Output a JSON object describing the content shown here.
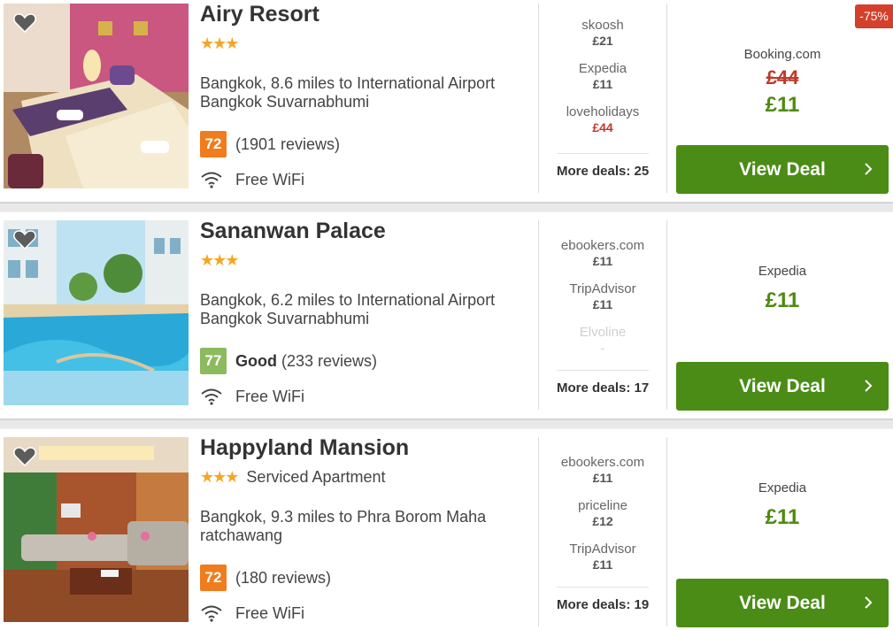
{
  "hotels": [
    {
      "name": "Airy Resort",
      "stars": "★★★",
      "stay_type": "",
      "location": "Bangkok, 8.6 miles to International Airport Bangkok Suvarnabhumi",
      "score": "72",
      "score_label": "",
      "reviews": "(1901 reviews)",
      "amenity": "Free WiFi",
      "deals": [
        {
          "provider": "skoosh",
          "price": "£21"
        },
        {
          "provider": "Expedia",
          "price": "£11"
        },
        {
          "provider": "loveholidays",
          "price": "£44"
        }
      ],
      "more_deals": "More deals: 25",
      "best": {
        "provider": "Booking.com",
        "old_price": "£44",
        "price": "£11"
      },
      "discount": "-75%",
      "button": "View Deal"
    },
    {
      "name": "Sananwan Palace",
      "stars": "★★★",
      "stay_type": "",
      "location": "Bangkok, 6.2 miles to International Airport Bangkok Suvarnabhumi",
      "score": "77",
      "score_label": "Good",
      "reviews": "(233 reviews)",
      "amenity": "Free WiFi",
      "deals": [
        {
          "provider": "ebookers.com",
          "price": "£11"
        },
        {
          "provider": "TripAdvisor",
          "price": "£11"
        },
        {
          "provider": "Elvoline",
          "price": "-"
        }
      ],
      "more_deals": "More deals: 17",
      "best": {
        "provider": "Expedia",
        "old_price": "",
        "price": "£11"
      },
      "discount": "",
      "button": "View Deal"
    },
    {
      "name": "Happyland Mansion",
      "stars": "★★★",
      "stay_type": "Serviced Apartment",
      "location": "Bangkok, 9.3 miles to Phra Borom Maha ratchawang",
      "score": "72",
      "score_label": "",
      "reviews": "(180 reviews)",
      "amenity": "Free WiFi",
      "deals": [
        {
          "provider": "ebookers.com",
          "price": "£11"
        },
        {
          "provider": "priceline",
          "price": "£12"
        },
        {
          "provider": "TripAdvisor",
          "price": "£11"
        }
      ],
      "more_deals": "More deals: 19",
      "best": {
        "provider": "Expedia",
        "old_price": "",
        "price": "£11"
      },
      "discount": "",
      "button": "View Deal"
    }
  ],
  "colors": {
    "accent_green": "#4a8c15",
    "price_green": "#4f8a10",
    "strike_red": "#c0392b",
    "badge_red": "#d3402b",
    "score_orange": "#f07c1e",
    "score_green": "#8cba5e",
    "star_gold": "#f5a623"
  },
  "icons": {
    "favorite": "heart-icon",
    "wifi": "wifi-icon",
    "chevron": "chevron-right-icon"
  }
}
